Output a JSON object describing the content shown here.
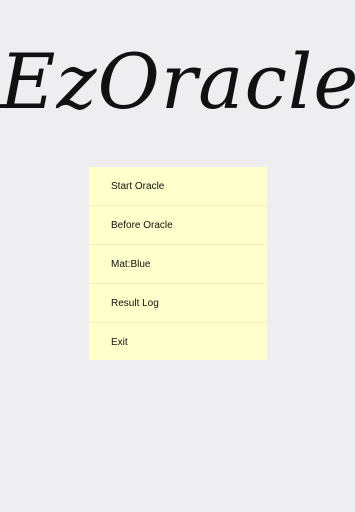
{
  "app": {
    "title": "EzOracle"
  },
  "menu": {
    "items": [
      {
        "id": "start-oracle",
        "label": "Start Oracle"
      },
      {
        "id": "before-oracle",
        "label": "Before Oracle"
      },
      {
        "id": "mat-blue",
        "label": "Mat:Blue"
      },
      {
        "id": "result-log",
        "label": "Result Log"
      },
      {
        "id": "exit",
        "label": "Exit"
      }
    ]
  },
  "colors": {
    "background": "#eeedf0",
    "menu_background": "#ffffcc",
    "text": "#111111"
  }
}
